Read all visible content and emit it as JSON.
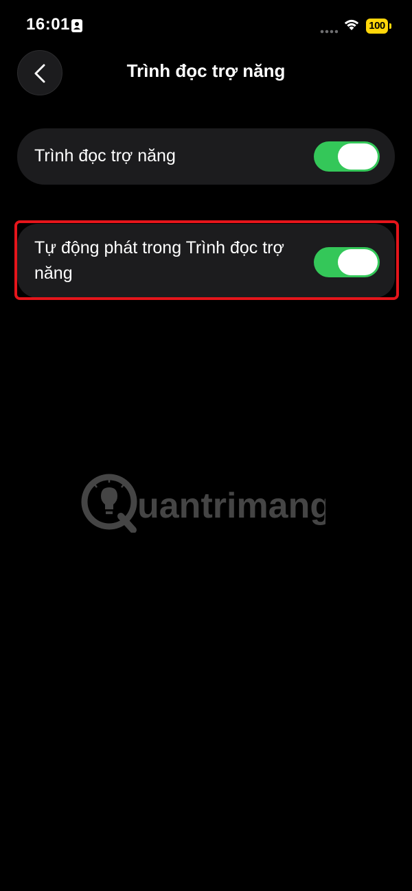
{
  "status_bar": {
    "time": "16:01",
    "battery_level": "100",
    "icons": [
      "portrait-lock-icon",
      "signal-dots-icon",
      "wifi-icon",
      "battery-icon"
    ]
  },
  "header": {
    "title": "Trình đọc trợ năng",
    "back_icon": "chevron-left-icon"
  },
  "settings": [
    {
      "label": "Trình đọc trợ năng",
      "enabled": true
    },
    {
      "label": "Tự động phát trong Trình đọc trợ năng",
      "enabled": true
    }
  ],
  "watermark": {
    "text": "uantrimang",
    "logo_letter": "Q"
  },
  "colors": {
    "background": "#000000",
    "card": "#1c1c1e",
    "toggle_on": "#34c759",
    "highlight": "#e5151b",
    "battery": "#ffd60a"
  }
}
